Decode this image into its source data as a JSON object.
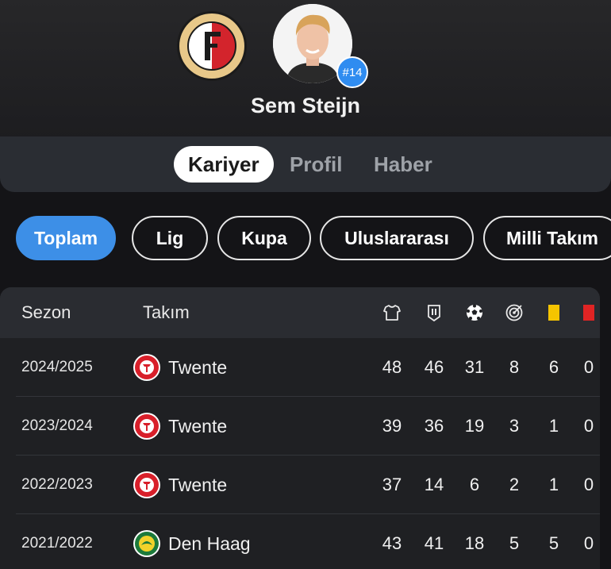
{
  "colors": {
    "accent": "#3d8fe7",
    "badge": "#2f8cf0",
    "yellow_card": "#f5c400",
    "red_card": "#e02424"
  },
  "header": {
    "club_logo_icon": "feyenoord-club-logo",
    "club_logo_text_top": "FEYENOORD",
    "club_logo_text_bottom": "ROTTERDAM",
    "club_logo_letter": "F",
    "avatar_icon": "player-photo",
    "shirt_number": "#14",
    "player_name": "Sem Steijn"
  },
  "tabs": [
    {
      "label": "Kariyer",
      "active": true
    },
    {
      "label": "Profil",
      "active": false
    },
    {
      "label": "Haber",
      "active": false
    }
  ],
  "filters": [
    {
      "label": "Toplam",
      "active": true
    },
    {
      "label": "Lig",
      "active": false
    },
    {
      "label": "Kupa",
      "active": false
    },
    {
      "label": "Uluslararası",
      "active": false
    },
    {
      "label": "Milli Takım",
      "active": false
    }
  ],
  "table": {
    "columns": {
      "season": "Sezon",
      "team": "Takım",
      "icons": [
        "shirt-icon",
        "lineup-icon",
        "ball-icon",
        "target-icon",
        "yellow-card-icon",
        "red-card-icon"
      ]
    },
    "rows": [
      {
        "season": "2024/2025",
        "team": "Twente",
        "team_icon": "twente-logo",
        "stats": [
          "48",
          "46",
          "31",
          "8",
          "6",
          "0"
        ]
      },
      {
        "season": "2023/2024",
        "team": "Twente",
        "team_icon": "twente-logo",
        "stats": [
          "39",
          "36",
          "19",
          "3",
          "1",
          "0"
        ]
      },
      {
        "season": "2022/2023",
        "team": "Twente",
        "team_icon": "twente-logo",
        "stats": [
          "37",
          "14",
          "6",
          "2",
          "1",
          "0"
        ]
      },
      {
        "season": "2021/2022",
        "team": "Den Haag",
        "team_icon": "den-haag-logo",
        "stats": [
          "43",
          "41",
          "18",
          "5",
          "5",
          "0"
        ]
      }
    ]
  }
}
